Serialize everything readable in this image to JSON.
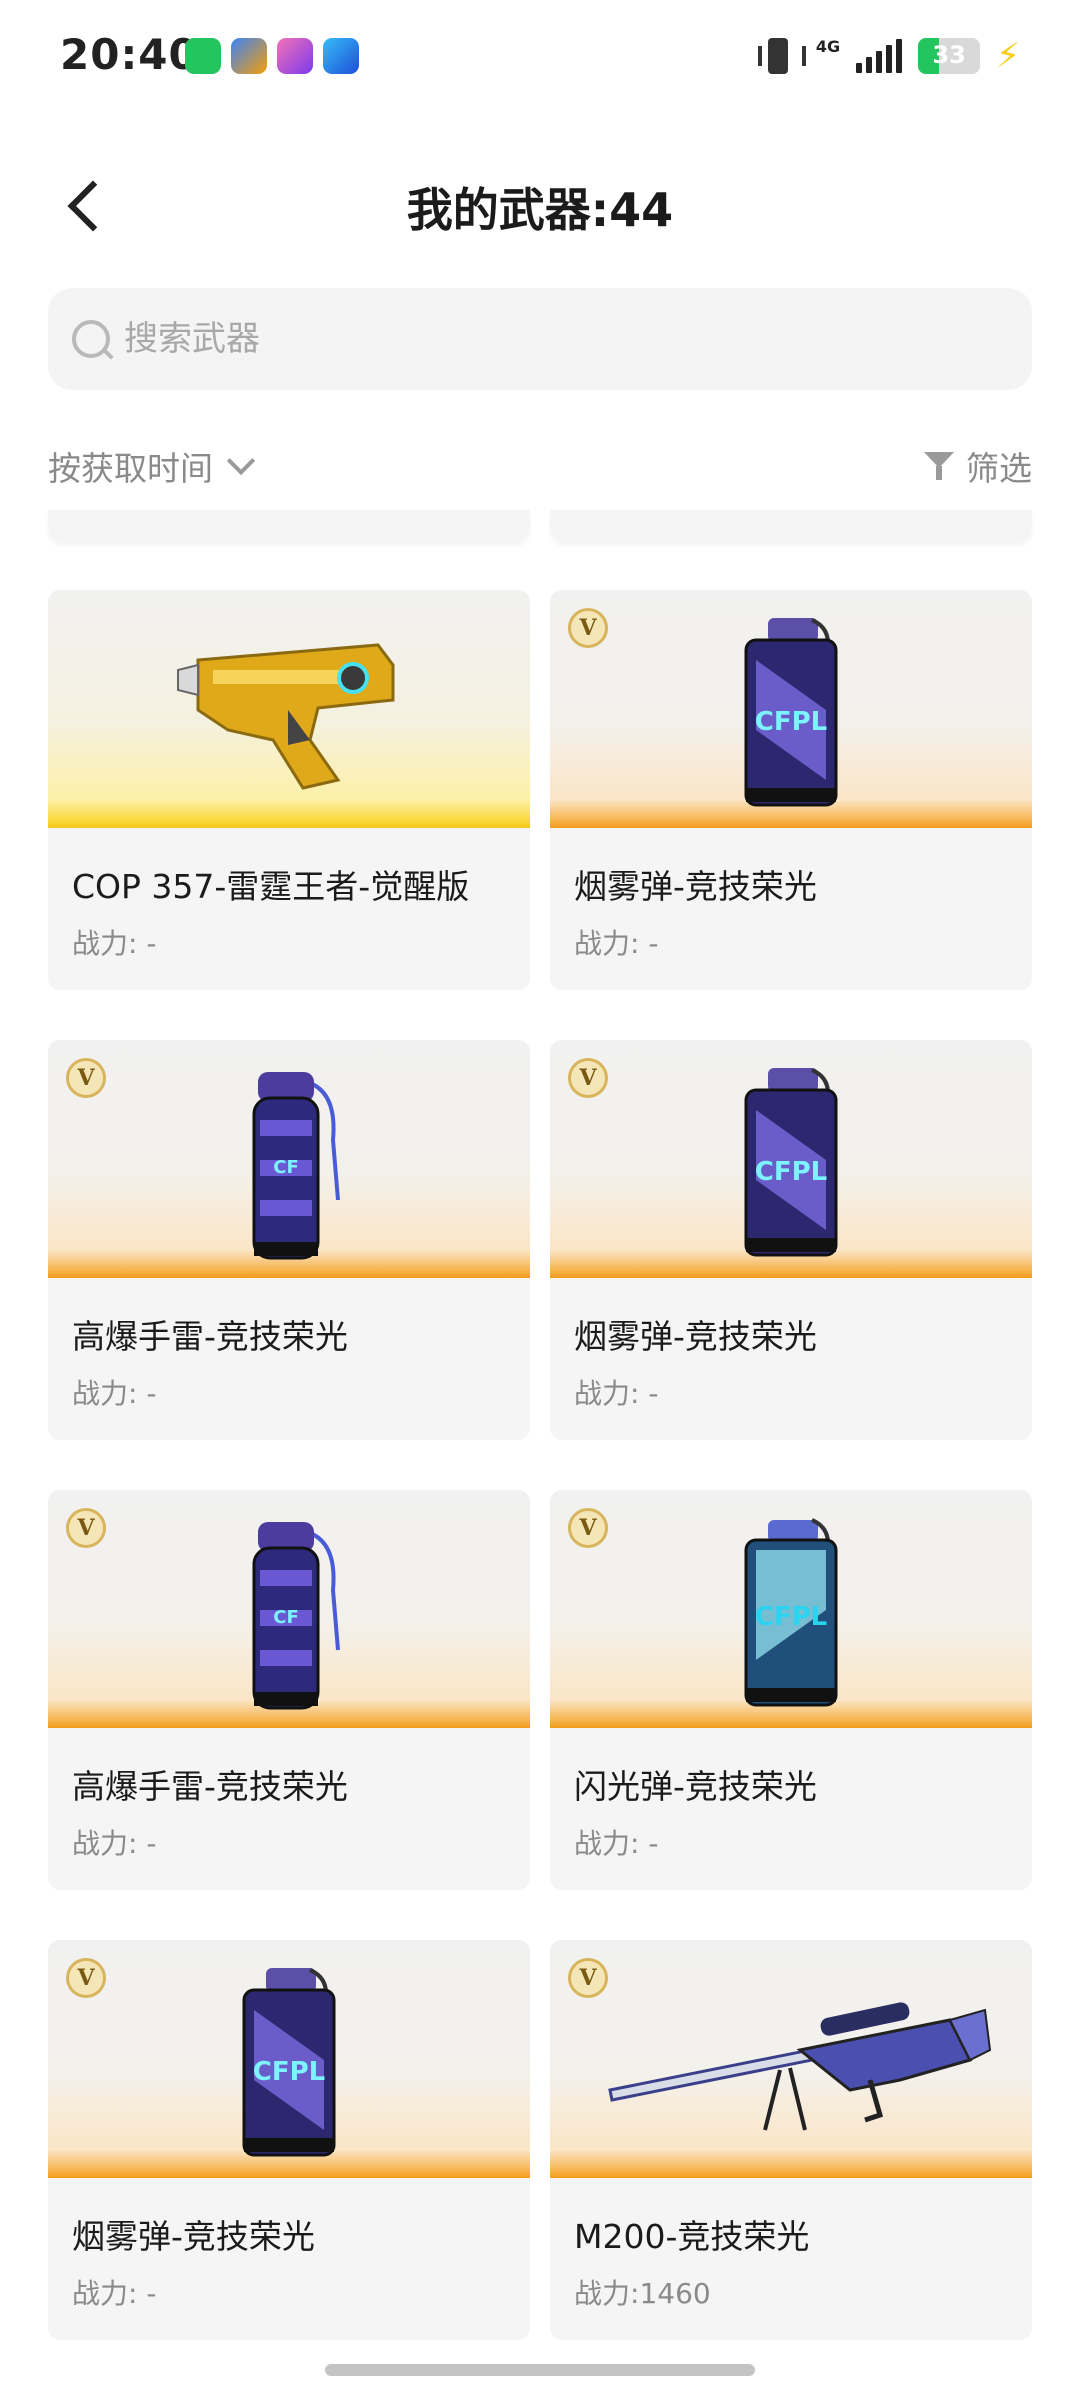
{
  "status_bar": {
    "time": "20:40",
    "network": "4G",
    "battery": "33"
  },
  "header": {
    "title": "我的武器:44"
  },
  "search": {
    "placeholder": "搜索武器"
  },
  "controls": {
    "sort_label": "按获取时间",
    "filter_label": "筛选"
  },
  "weapons": [
    {
      "name": "COP 357-雷霆王者-觉醒版",
      "power_label": "战力:",
      "power_value": " -",
      "badge": "",
      "art": "pistol-gold-icon"
    },
    {
      "name": "烟雾弹-竞技荣光",
      "power_label": "战力:",
      "power_value": " -",
      "badge": "V",
      "art": "smoke-grenade-icon"
    },
    {
      "name": "高爆手雷-竞技荣光",
      "power_label": "战力:",
      "power_value": " -",
      "badge": "V",
      "art": "frag-grenade-icon"
    },
    {
      "name": "烟雾弹-竞技荣光",
      "power_label": "战力:",
      "power_value": " -",
      "badge": "V",
      "art": "smoke-grenade-icon"
    },
    {
      "name": "高爆手雷-竞技荣光",
      "power_label": "战力:",
      "power_value": " -",
      "badge": "V",
      "art": "frag-grenade-icon"
    },
    {
      "name": "闪光弹-竞技荣光",
      "power_label": "战力:",
      "power_value": " -",
      "badge": "V",
      "art": "flash-grenade-icon"
    },
    {
      "name": "烟雾弹-竞技荣光",
      "power_label": "战力:",
      "power_value": " -",
      "badge": "V",
      "art": "smoke-grenade-icon"
    },
    {
      "name": "M200-竞技荣光",
      "power_label": "战力:",
      "power_value": "1460",
      "badge": "V",
      "art": "sniper-rifle-icon"
    }
  ]
}
